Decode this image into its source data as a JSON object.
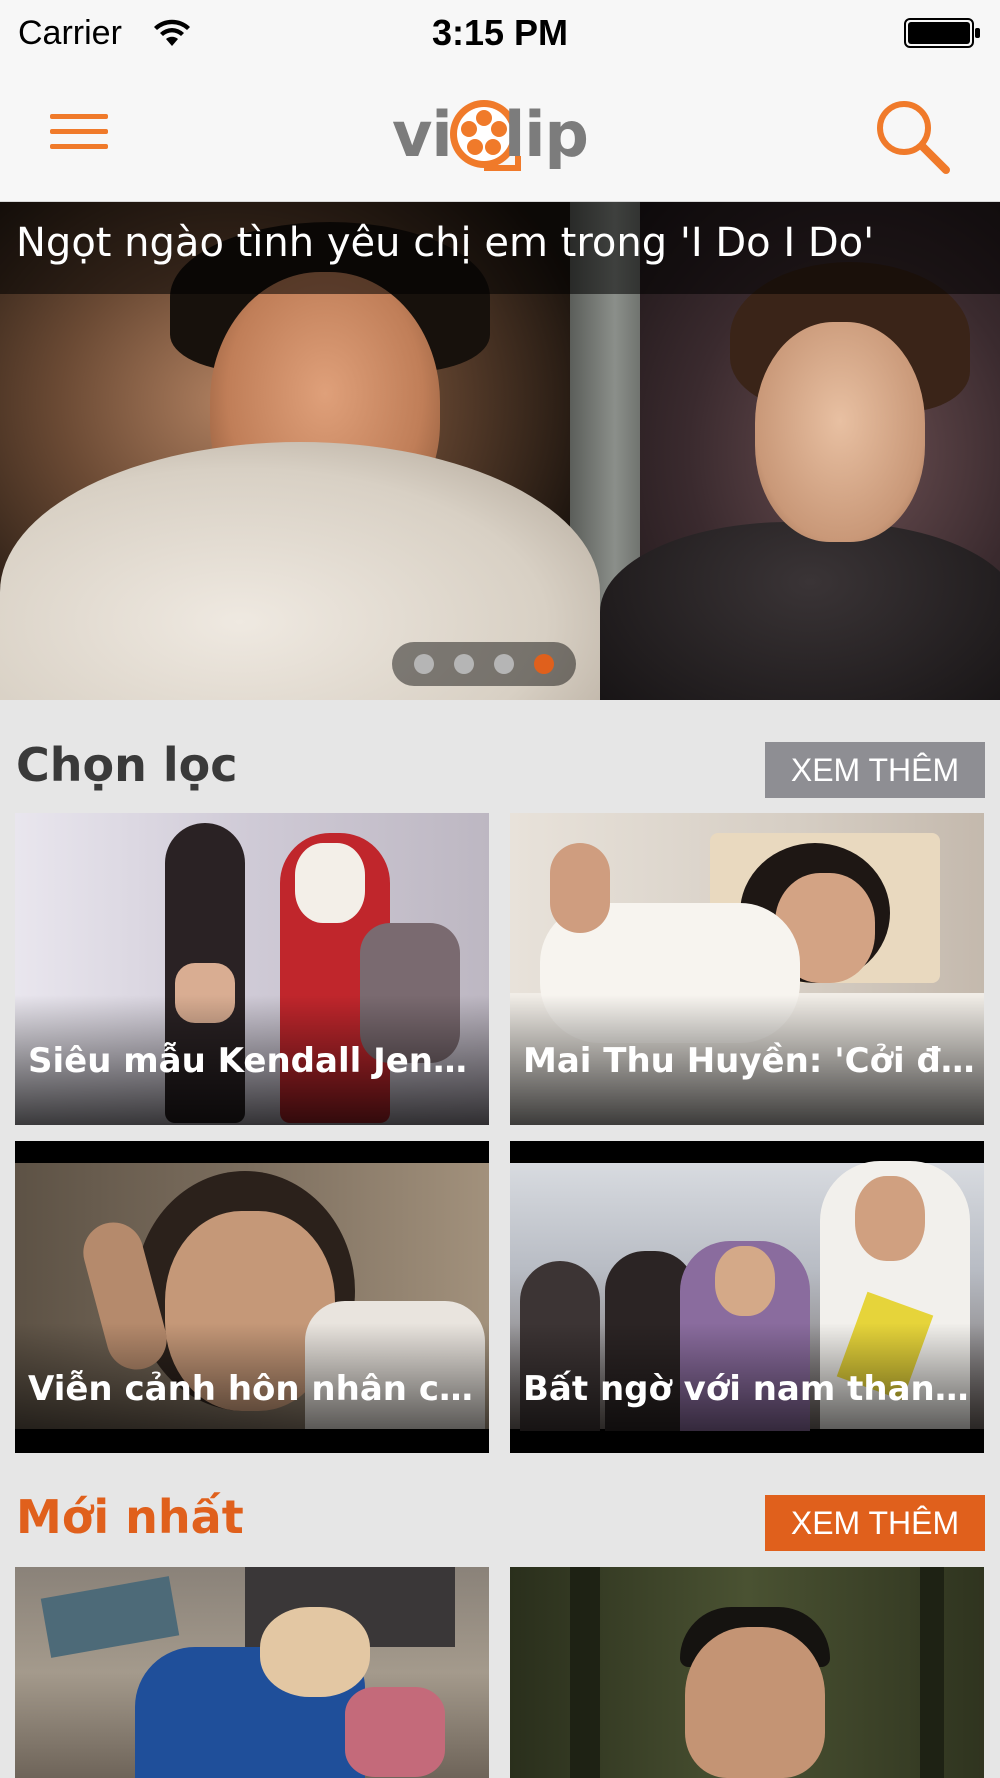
{
  "status_bar": {
    "carrier": "Carrier",
    "time": "3:15 PM"
  },
  "nav": {
    "logo_left": "vi",
    "logo_right": "lip",
    "accent_color": "#f07a2a"
  },
  "hero": {
    "title": "Ngọt ngào tình yêu chị em trong 'I Do I Do'",
    "pages": 4,
    "active_page": 4
  },
  "sections": [
    {
      "title": "Chọn lọc",
      "title_color": "#3a3a3a",
      "more_label": "XEM THÊM",
      "more_color": "#8e8e93",
      "videos": [
        {
          "title": "Siêu mẫu Kendall Jenner khoe dáng"
        },
        {
          "title": "Mai Thu Huyền: 'Cởi đồ là chuyện bình thường'"
        },
        {
          "title": "Viễn cảnh hôn nhân cực kỳ đáng sợ"
        },
        {
          "title": "Bất ngờ với nam thanh niên"
        }
      ]
    },
    {
      "title": "Mới nhất",
      "title_color": "#e0601c",
      "more_label": "XEM THÊM",
      "more_color": "#e0601c",
      "videos": [
        {
          "title": ""
        },
        {
          "title": ""
        }
      ]
    }
  ]
}
